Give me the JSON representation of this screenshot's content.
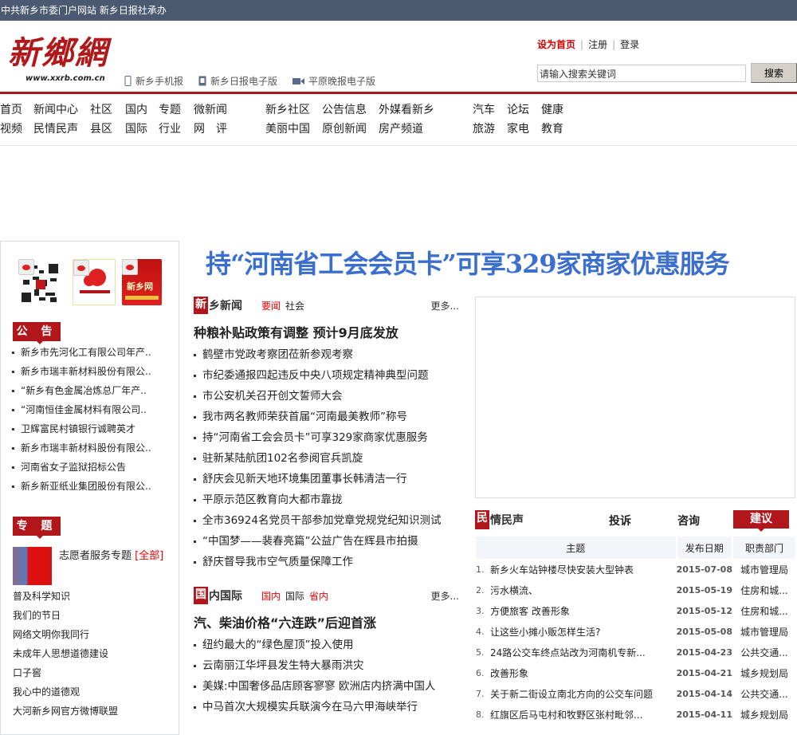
{
  "topbar": {
    "text": "中共新乡市委门户网站 新乡日报社承办"
  },
  "logo": {
    "name": "新鄉網",
    "url": "www.xxrb.com.cn"
  },
  "sublinks": [
    {
      "label": "新乡手机报",
      "icon": "mobile-icon"
    },
    {
      "label": "新乡日报电子版",
      "icon": "tablet-icon"
    },
    {
      "label": "平原晚报电子版",
      "icon": "video-camera-icon"
    }
  ],
  "toplinks": {
    "set_home": "设为首页",
    "register": "注册",
    "login": "登录"
  },
  "search": {
    "placeholder": "请输入搜索关键词",
    "button": "搜索"
  },
  "nav": {
    "row1": [
      "首页",
      "新闻中心",
      "社区",
      "国内",
      "专题",
      "微新闻",
      "新乡社区",
      "公告信息",
      "外媒看新乡",
      "汽车",
      "论坛",
      "健康"
    ],
    "row2": [
      "视频",
      "民情民声",
      "县区",
      "国际",
      "行业",
      "网　评",
      "美丽中国",
      "原创新闻",
      "房产频道",
      "旅游",
      "家电",
      "教育"
    ]
  },
  "sidebar": {
    "notice_title": "公 告",
    "notices": [
      "新乡市先河化工有限公司年产..",
      "新乡市瑞丰新材料股份有限公..",
      "“新乡有色金属冶炼总厂年产..",
      "“河南恒佳金属材料有限公司..",
      "卫辉富民村镇银行诚聘英才",
      "新乡市瑞丰新材料股份有限公..",
      "河南省女子监狱招标公告",
      "新乡新亚纸业集团股份有限公.."
    ],
    "topic_title": "专 题",
    "topic_main": "志愿者服务专题",
    "topic_all": "[全部]",
    "topics": [
      "普及科学知识",
      "我们的节日",
      "网络文明你我同行",
      "未成年人思想道德建设",
      "口子窖",
      "我心中的道德观",
      "大河新乡网官方微博联盟"
    ]
  },
  "headline": "持“河南省工会会员卡”可享329家商家优惠服务",
  "xinxiang_news": {
    "icon_char": "新",
    "title": "乡新闻",
    "tabs": [
      "要闻",
      "社会"
    ],
    "more": "更多...",
    "lead": "种粮补贴政策有调整 预计9月底发放",
    "items": [
      "鹤壁市党政考察团莅新参观考察",
      "市纪委通报四起违反中央八项规定精神典型问题",
      "市公安机关召开创文誓师大会",
      "我市两名教师荣获首届“河南最美教师”称号",
      "持“河南省工会会员卡”可享329家商家优惠服务",
      "驻新某陆航团102名参阅官兵凯旋",
      "舒庆会见新天地环境集团董事长韩清洁一行",
      "平原示范区教育向大都市靠拢",
      "全市36924名党员干部参加党章党规党纪知识测试",
      "“中国梦——裴春亮篇”公益广告在辉县市拍摄",
      "舒庆督导我市空气质量保障工作"
    ]
  },
  "intl_news": {
    "icon_char": "国",
    "title": "内国际",
    "tabs": [
      "国内",
      "国际",
      "省内"
    ],
    "more": "更多...",
    "lead": "汽、柴油价格“六连跌”后迎首涨",
    "items": [
      "纽约最大的“绿色屋顶”投入使用",
      "云南丽江华坪县发生特大暴雨洪灾",
      "美媒:中国奢侈品店顾客寥寥 欧洲店内挤满中国人",
      "中马首次大规模实兵联演今在马六甲海峡举行"
    ]
  },
  "minqing": {
    "icon_char": "民",
    "title": "情民声",
    "tabs": [
      "投诉",
      "咨询",
      "建议"
    ],
    "columns": [
      "主题",
      "发布日期",
      "职责部门"
    ],
    "rows": [
      {
        "n": "1.",
        "subject": "新乡火车站钟楼尽快安装大型钟表",
        "date": "2015-07-08",
        "dept": "城市管理局"
      },
      {
        "n": "2.",
        "subject": "污水横流、",
        "date": "2015-05-19",
        "dept": "住房和城..."
      },
      {
        "n": "3.",
        "subject": "方便旅客 改善形象",
        "date": "2015-05-12",
        "dept": "住房和城..."
      },
      {
        "n": "4.",
        "subject": "让这些小摊小贩怎样生活?",
        "date": "2015-05-08",
        "dept": "城市管理局"
      },
      {
        "n": "5.",
        "subject": "24路公交车终点站改为河南机专新...",
        "date": "2015-04-23",
        "dept": "公共交通..."
      },
      {
        "n": "6.",
        "subject": "改善形象",
        "date": "2015-04-21",
        "dept": "城乡规划局"
      },
      {
        "n": "7.",
        "subject": "关于新二街设立南北方向的公交车问题",
        "date": "2015-04-14",
        "dept": "公共交通..."
      },
      {
        "n": "8.",
        "subject": "红旗区后马屯村和牧野区张村毗邻...",
        "date": "2015-04-11",
        "dept": "城乡规划局"
      }
    ]
  },
  "colors": {
    "brand_red": "#b0161a",
    "topbar": "#4b5a70",
    "headline_blue": "#3a6fd0"
  }
}
